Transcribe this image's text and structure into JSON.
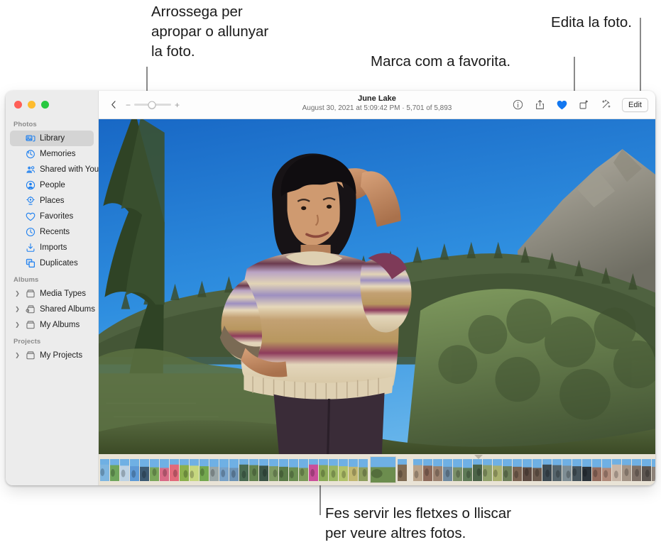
{
  "callouts": [
    {
      "id": "zoom",
      "text": "Arrossega per\napropar o allunyar\nla foto."
    },
    {
      "id": "favorite",
      "text": "Marca com a favorita."
    },
    {
      "id": "edit",
      "text": "Edita la foto."
    },
    {
      "id": "filmstrip",
      "text": "Fes servir les fletxes o lliscar\nper veure altres fotos."
    }
  ],
  "window": {
    "traffic_lights": [
      "close",
      "minimize",
      "zoom"
    ]
  },
  "sidebar": {
    "sections": [
      {
        "title": "Photos",
        "items": [
          {
            "label": "Library",
            "icon": "library-icon",
            "selected": true,
            "disclosure": false
          },
          {
            "label": "Memories",
            "icon": "memories-icon",
            "selected": false,
            "disclosure": false
          },
          {
            "label": "Shared with You",
            "icon": "shared-with-you-icon",
            "selected": false,
            "disclosure": false
          },
          {
            "label": "People",
            "icon": "people-icon",
            "selected": false,
            "disclosure": false
          },
          {
            "label": "Places",
            "icon": "places-icon",
            "selected": false,
            "disclosure": false
          },
          {
            "label": "Favorites",
            "icon": "heart-icon",
            "selected": false,
            "disclosure": false
          },
          {
            "label": "Recents",
            "icon": "clock-icon",
            "selected": false,
            "disclosure": false
          },
          {
            "label": "Imports",
            "icon": "import-icon",
            "selected": false,
            "disclosure": false
          },
          {
            "label": "Duplicates",
            "icon": "duplicates-icon",
            "selected": false,
            "disclosure": false
          }
        ]
      },
      {
        "title": "Albums",
        "items": [
          {
            "label": "Media Types",
            "icon": "album-icon",
            "selected": false,
            "disclosure": true
          },
          {
            "label": "Shared Albums",
            "icon": "shared-album-icon",
            "selected": false,
            "disclosure": true
          },
          {
            "label": "My Albums",
            "icon": "album-icon",
            "selected": false,
            "disclosure": true
          }
        ]
      },
      {
        "title": "Projects",
        "items": [
          {
            "label": "My Projects",
            "icon": "album-icon",
            "selected": false,
            "disclosure": true
          }
        ]
      }
    ]
  },
  "toolbar": {
    "back_icon": "chevron-left-icon",
    "zoom_minus": "−",
    "zoom_plus": "+",
    "zoom_value": 48,
    "title": "June Lake",
    "subtitle": "August 30, 2021 at 5:09:42 PM  ·  5,701 of 5,893",
    "date": "August 30, 2021 at 5:09:42 PM",
    "position": "5,701 of 5,893",
    "actions": [
      {
        "name": "info-icon",
        "label": "Info"
      },
      {
        "name": "share-icon",
        "label": "Share"
      },
      {
        "name": "favorite-heart-icon",
        "label": "Favorite",
        "active": true,
        "color": "#1277f0"
      },
      {
        "name": "rotate-icon",
        "label": "Rotate"
      },
      {
        "name": "enhance-icon",
        "label": "Auto Enhance"
      }
    ],
    "edit_label": "Edit"
  },
  "photo": {
    "alt": "Woman in striped knit sweater shielding eyes, mountain lake and pine forest behind",
    "sky": "#2f8fe0",
    "mountain": "#8e8d82",
    "forest": "#4b5c3c",
    "water": "#5a6a52"
  },
  "filmstrip": {
    "strip_color": "#e9e3d6",
    "current_index": 27,
    "thumbs": [
      "#7fb6e0",
      "#6fa55c",
      "#bcd2e4",
      "#5e9ad6",
      "#3d5a72",
      "#7aa65a",
      "#d96a86",
      "#e26a7a",
      "#8bb04d",
      "#c6d77f",
      "#74a84f",
      "#9aa7a8",
      "#79a2c8",
      "#6d93b5",
      "#4a6b52",
      "#63844f",
      "#3c5546",
      "#7e9a62",
      "#5a7b48",
      "#6b8f52",
      "#7c9a5a",
      "#c94f9a",
      "#8aa957",
      "#9ab662",
      "#b2c36a",
      "#c2b870",
      "#8d9e5d",
      "#6c8d4e",
      "#7f6a52",
      "#b9a289",
      "#8d6a5a",
      "#9c8270",
      "#6f8aa0",
      "#7a8f68",
      "#5e7a56",
      "#4c6448",
      "#8fa06a",
      "#a9b06f",
      "#6d7f5a",
      "#7a6352",
      "#5d4b42",
      "#6b5a4e",
      "#3d4a52",
      "#55646b",
      "#7e8d94",
      "#46545c",
      "#2b333a",
      "#946c5e",
      "#b08a7a",
      "#c9b7a8",
      "#a49486",
      "#7d6f66",
      "#5c5550",
      "#8c8279",
      "#6e6660",
      "#4f4a46"
    ]
  }
}
